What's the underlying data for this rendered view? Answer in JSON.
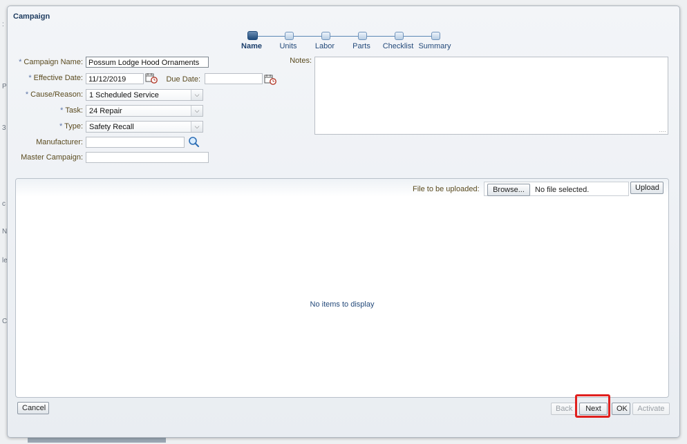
{
  "dialog": {
    "title": "Campaign"
  },
  "train": {
    "steps": [
      "Name",
      "Units",
      "Labor",
      "Parts",
      "Checklist",
      "Summary"
    ],
    "active_index": 0
  },
  "form": {
    "campaign_name": {
      "label": "Campaign Name:",
      "value": "Possum Lodge Hood Ornaments",
      "required": true
    },
    "effective_date": {
      "label": "Effective Date:",
      "value": "11/12/2019",
      "required": true
    },
    "due_date": {
      "label": "Due Date:",
      "value": ""
    },
    "cause_reason": {
      "label": "Cause/Reason:",
      "value": "1 Scheduled Service",
      "required": true
    },
    "task": {
      "label": "Task:",
      "value": "24 Repair",
      "required": true
    },
    "type": {
      "label": "Type:",
      "value": "Safety Recall",
      "required": true
    },
    "manufacturer": {
      "label": "Manufacturer:",
      "value": ""
    },
    "master_campaign": {
      "label": "Master Campaign:",
      "value": ""
    },
    "notes": {
      "label": "Notes:",
      "value": ""
    },
    "required_marker": "*"
  },
  "upload": {
    "label": "File to be uploaded:",
    "browse_label": "Browse...",
    "file_status": "No file selected.",
    "upload_label": "Upload"
  },
  "table": {
    "empty_message": "No items to display"
  },
  "footer": {
    "cancel": "Cancel",
    "back": "Back",
    "next": "Next",
    "ok": "OK",
    "activate": "Activate"
  },
  "colors": {
    "highlight": "#e0201e",
    "accent": "#1f4a7a"
  },
  "icons": {
    "calendar": "calendar-icon",
    "search": "magnifier-icon",
    "dropdown": "chevron-down-icon"
  }
}
